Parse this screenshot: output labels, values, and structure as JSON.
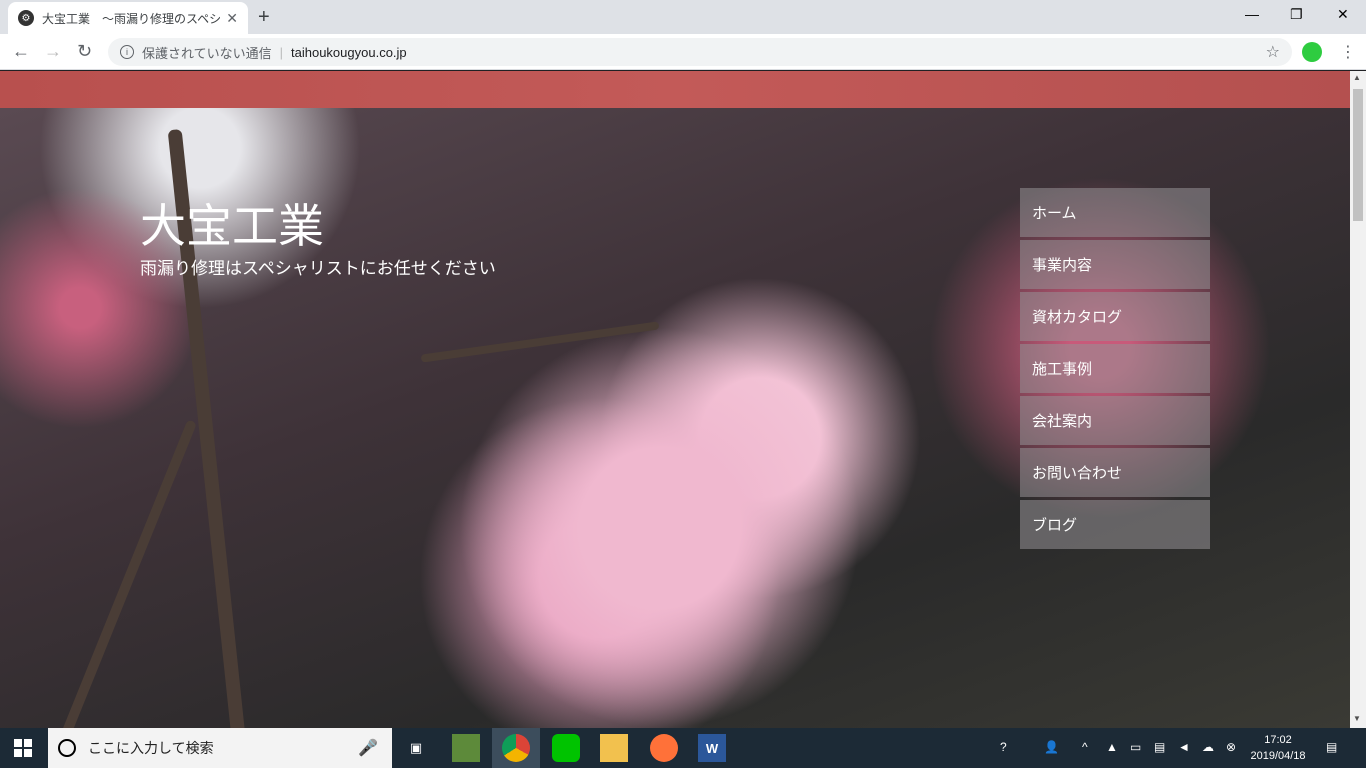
{
  "browser": {
    "tab_title": "大宝工業　～雨漏り修理のスペシャ",
    "tab_close": "✕",
    "new_tab": "+",
    "window_controls": {
      "minimize": "—",
      "maximize": "❐",
      "close": "✕"
    },
    "nav": {
      "back": "←",
      "forward": "→",
      "reload": "↻"
    },
    "security_label": "保護されていない通信",
    "url": "taihoukougyou.co.jp",
    "bookmark_star": "☆",
    "menu_dots": "⋮"
  },
  "page": {
    "site_title": "大宝工業",
    "site_subtitle": "雨漏り修理はスペシャリストにお任せください",
    "nav_items": [
      "ホーム",
      "事業内容",
      "資材カタログ",
      "施工事例",
      "会社案内",
      "お問い合わせ",
      "ブログ"
    ]
  },
  "taskbar": {
    "search_placeholder": "ここに入力して検索",
    "clock_time": "17:02",
    "clock_date": "2019/04/18"
  }
}
